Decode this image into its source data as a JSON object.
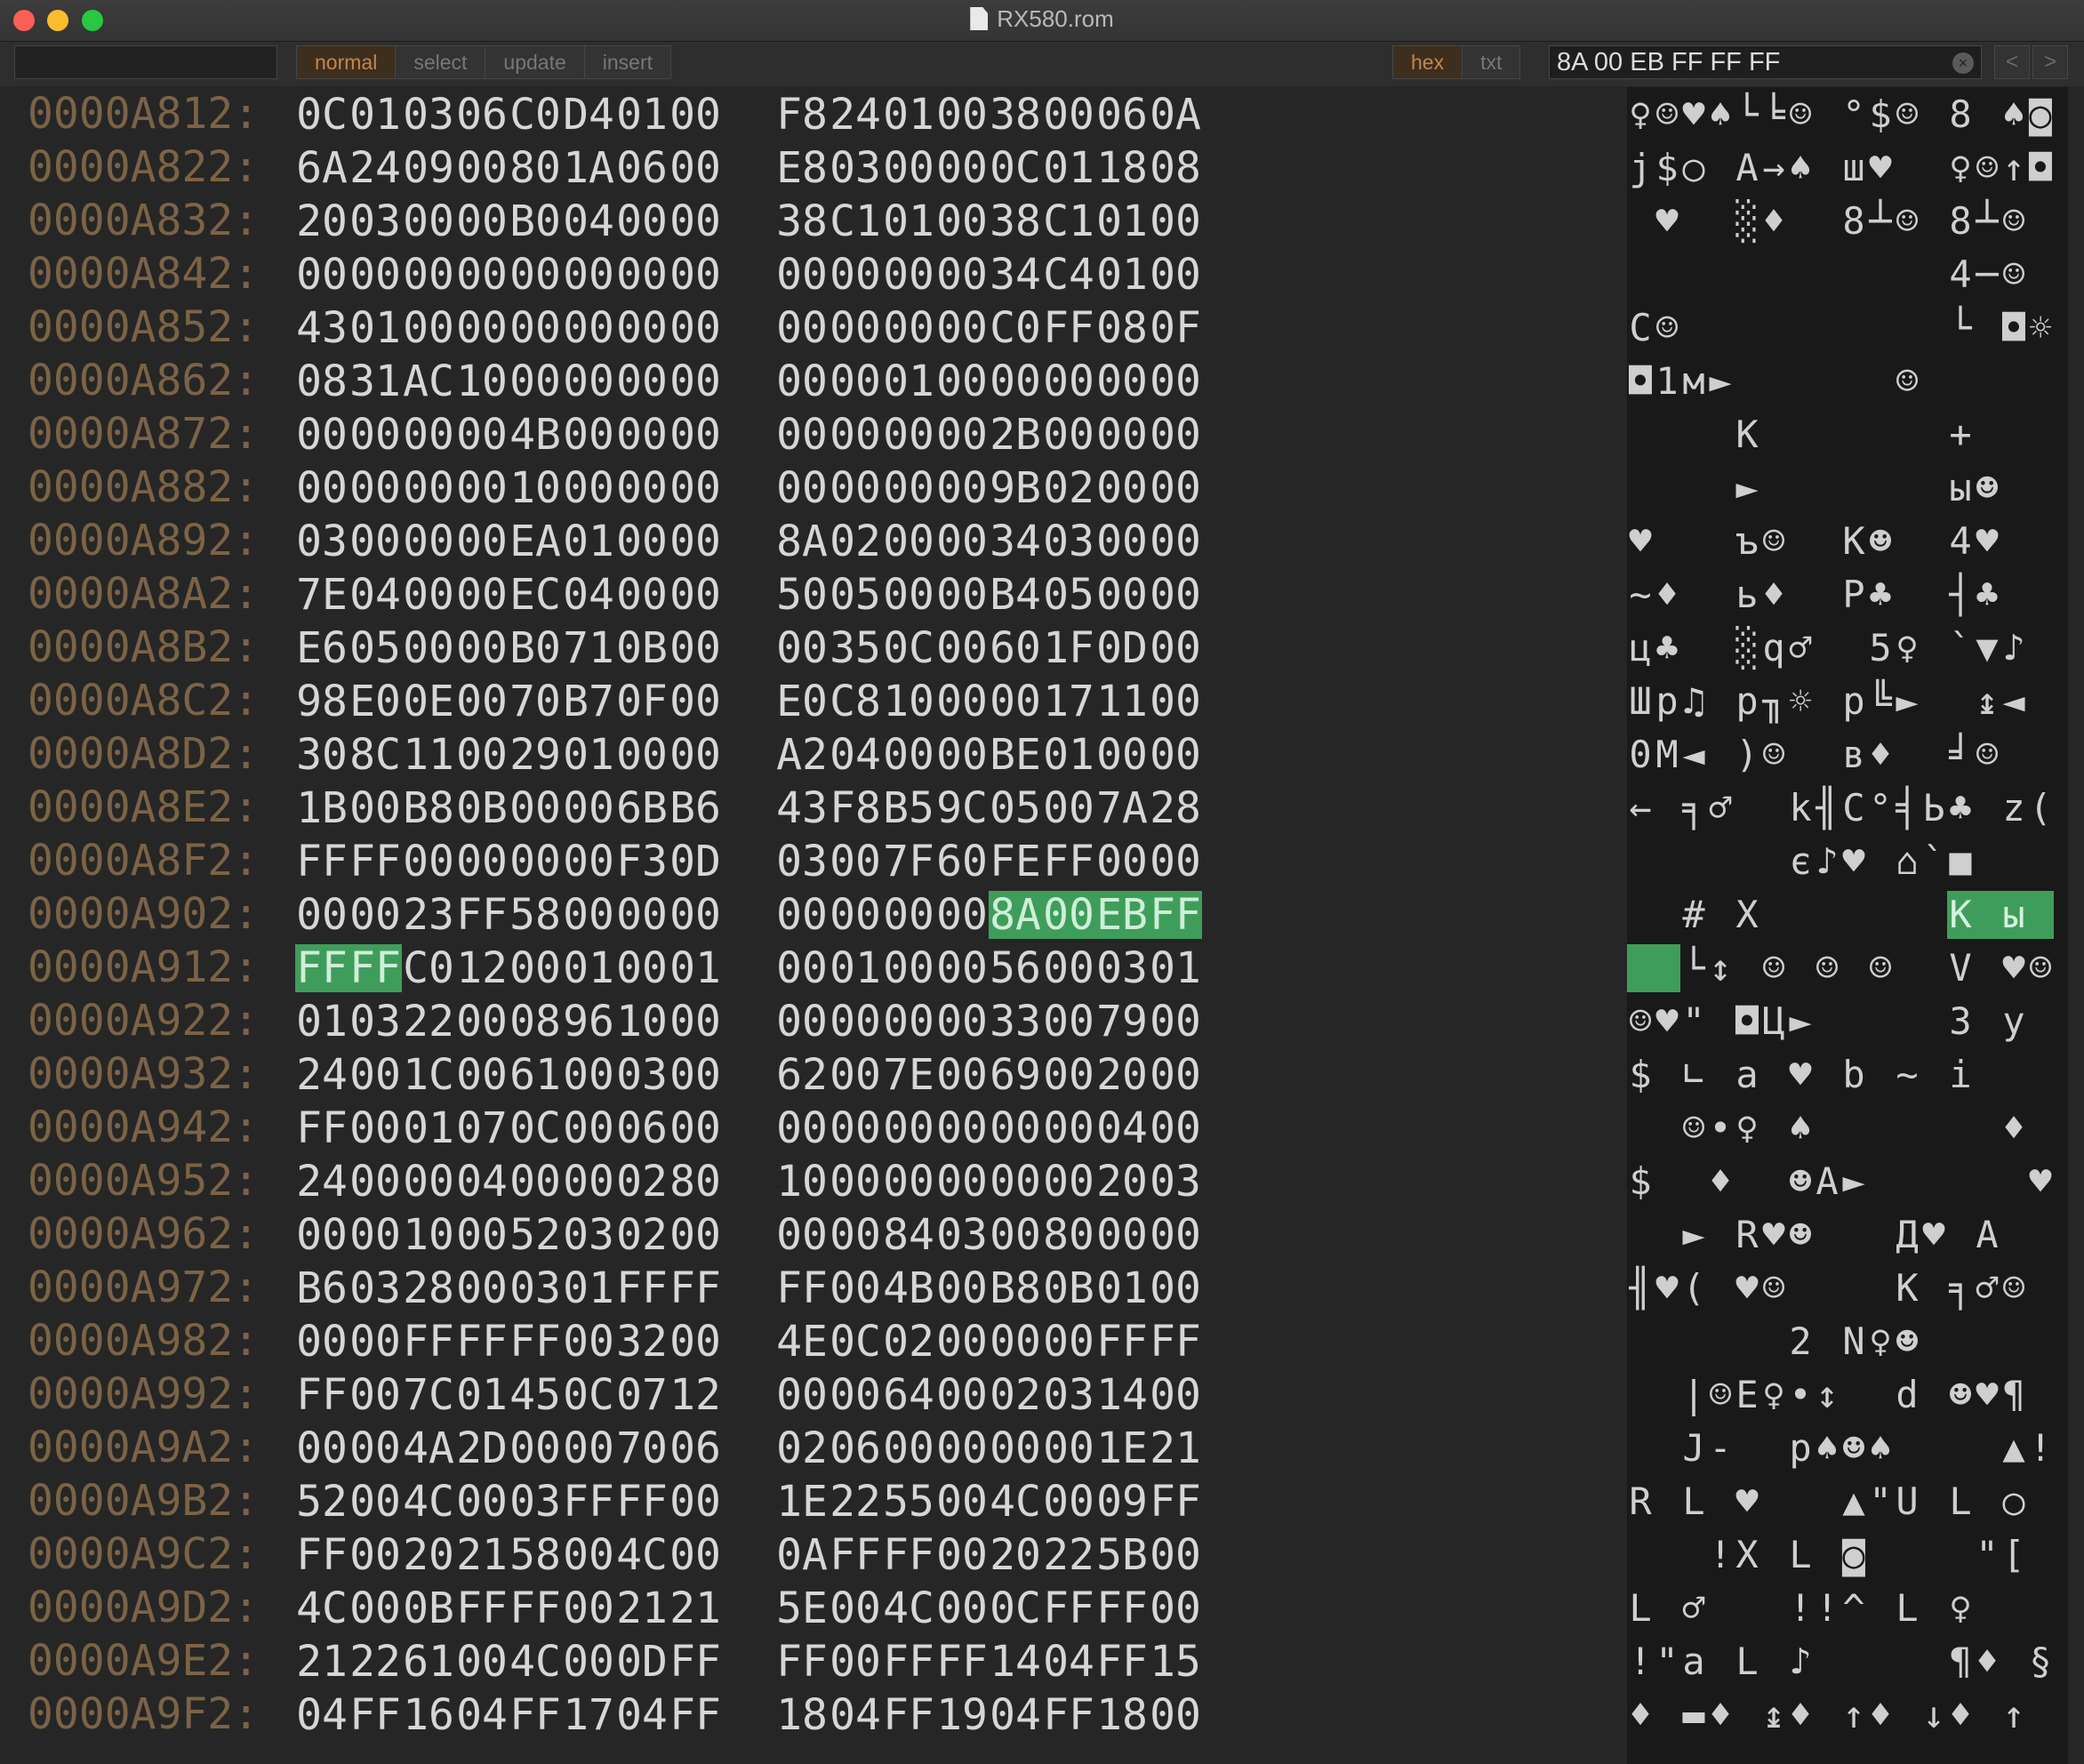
{
  "window": {
    "title": "RX580.rom"
  },
  "toolbar": {
    "modes": [
      {
        "label": "normal",
        "active": true
      },
      {
        "label": "select",
        "active": false
      },
      {
        "label": "update",
        "active": false
      },
      {
        "label": "insert",
        "active": false
      }
    ],
    "views": [
      {
        "label": "hex",
        "active": true
      },
      {
        "label": "txt",
        "active": false
      }
    ],
    "search_value": "8A 00 EB FF FF FF",
    "prev_label": "<",
    "next_label": ">"
  },
  "colors": {
    "background": "#262626",
    "address": "#7b6346",
    "highlight": "#3f9d5b",
    "active_mode": "#c2874d"
  },
  "rows": [
    {
      "address": "0000A812:",
      "bytes": [
        "0C",
        "01",
        "03",
        "06",
        "C0",
        "D4",
        "01",
        "00",
        "F8",
        "24",
        "01",
        "00",
        "38",
        "00",
        "06",
        "0A"
      ],
      "ascii": [
        "♀",
        "☺",
        "♥",
        "♠",
        "└",
        "╘",
        "☺",
        " ",
        "°",
        "$",
        "☺",
        " ",
        "8",
        " ",
        "♠",
        "◙"
      ]
    },
    {
      "address": "0000A822:",
      "bytes": [
        "6A",
        "24",
        "09",
        "00",
        "80",
        "1A",
        "06",
        "00",
        "E8",
        "03",
        "00",
        "00",
        "0C",
        "01",
        "18",
        "08"
      ],
      "ascii": [
        "j",
        "$",
        "○",
        " ",
        "А",
        "→",
        "♠",
        " ",
        "ш",
        "♥",
        " ",
        " ",
        "♀",
        "☺",
        "↑",
        "◘"
      ]
    },
    {
      "address": "0000A832:",
      "bytes": [
        "20",
        "03",
        "00",
        "00",
        "B0",
        "04",
        "00",
        "00",
        "38",
        "C1",
        "01",
        "00",
        "38",
        "C1",
        "01",
        "00"
      ],
      "ascii": [
        " ",
        "♥",
        " ",
        " ",
        "░",
        "♦",
        " ",
        " ",
        "8",
        "┴",
        "☺",
        " ",
        "8",
        "┴",
        "☺",
        " "
      ]
    },
    {
      "address": "0000A842:",
      "bytes": [
        "00",
        "00",
        "00",
        "00",
        "00",
        "00",
        "00",
        "00",
        "00",
        "00",
        "00",
        "00",
        "34",
        "C4",
        "01",
        "00"
      ],
      "ascii": [
        " ",
        " ",
        " ",
        " ",
        " ",
        " ",
        " ",
        " ",
        " ",
        " ",
        " ",
        " ",
        "4",
        "─",
        "☺",
        " "
      ]
    },
    {
      "address": "0000A852:",
      "bytes": [
        "43",
        "01",
        "00",
        "00",
        "00",
        "00",
        "00",
        "00",
        "00",
        "00",
        "00",
        "00",
        "C0",
        "FF",
        "08",
        "0F"
      ],
      "ascii": [
        "C",
        "☺",
        " ",
        " ",
        " ",
        " ",
        " ",
        " ",
        " ",
        " ",
        " ",
        " ",
        "└",
        " ",
        "◘",
        "☼"
      ]
    },
    {
      "address": "0000A862:",
      "bytes": [
        "08",
        "31",
        "AC",
        "10",
        "00",
        "00",
        "00",
        "00",
        "00",
        "00",
        "01",
        "00",
        "00",
        "00",
        "00",
        "00"
      ],
      "ascii": [
        "◘",
        "1",
        "м",
        "►",
        " ",
        " ",
        " ",
        " ",
        " ",
        " ",
        "☺",
        " ",
        " ",
        " ",
        " ",
        " "
      ]
    },
    {
      "address": "0000A872:",
      "bytes": [
        "00",
        "00",
        "00",
        "00",
        "4B",
        "00",
        "00",
        "00",
        "00",
        "00",
        "00",
        "00",
        "2B",
        "00",
        "00",
        "00"
      ],
      "ascii": [
        " ",
        " ",
        " ",
        " ",
        "K",
        " ",
        " ",
        " ",
        " ",
        " ",
        " ",
        " ",
        "+",
        " ",
        " ",
        " "
      ]
    },
    {
      "address": "0000A882:",
      "bytes": [
        "00",
        "00",
        "00",
        "00",
        "10",
        "00",
        "00",
        "00",
        "00",
        "00",
        "00",
        "00",
        "9B",
        "02",
        "00",
        "00"
      ],
      "ascii": [
        " ",
        " ",
        " ",
        " ",
        "►",
        " ",
        " ",
        " ",
        " ",
        " ",
        " ",
        " ",
        "ы",
        "☻",
        " ",
        " "
      ]
    },
    {
      "address": "0000A892:",
      "bytes": [
        "03",
        "00",
        "00",
        "00",
        "EA",
        "01",
        "00",
        "00",
        "8A",
        "02",
        "00",
        "00",
        "34",
        "03",
        "00",
        "00"
      ],
      "ascii": [
        "♥",
        " ",
        " ",
        " ",
        "ъ",
        "☺",
        " ",
        " ",
        "К",
        "☻",
        " ",
        " ",
        "4",
        "♥",
        " ",
        " "
      ]
    },
    {
      "address": "0000A8A2:",
      "bytes": [
        "7E",
        "04",
        "00",
        "00",
        "EC",
        "04",
        "00",
        "00",
        "50",
        "05",
        "00",
        "00",
        "B4",
        "05",
        "00",
        "00"
      ],
      "ascii": [
        "~",
        "♦",
        " ",
        " ",
        "ь",
        "♦",
        " ",
        " ",
        "P",
        "♣",
        " ",
        " ",
        "┤",
        "♣",
        " ",
        " "
      ]
    },
    {
      "address": "0000A8B2:",
      "bytes": [
        "E6",
        "05",
        "00",
        "00",
        "B0",
        "71",
        "0B",
        "00",
        "00",
        "35",
        "0C",
        "00",
        "60",
        "1F",
        "0D",
        "00"
      ],
      "ascii": [
        "ц",
        "♣",
        " ",
        " ",
        "░",
        "q",
        "♂",
        " ",
        " ",
        "5",
        "♀",
        " ",
        "`",
        "▼",
        "♪",
        " "
      ]
    },
    {
      "address": "0000A8C2:",
      "bytes": [
        "98",
        "E0",
        "0E",
        "00",
        "70",
        "B7",
        "0F",
        "00",
        "E0",
        "C8",
        "10",
        "00",
        "00",
        "17",
        "11",
        "00"
      ],
      "ascii": [
        "Ш",
        "р",
        "♫",
        " ",
        "p",
        "╖",
        "☼",
        " ",
        "р",
        "╚",
        "►",
        " ",
        " ",
        "↨",
        "◄",
        " "
      ]
    },
    {
      "address": "0000A8D2:",
      "bytes": [
        "30",
        "8C",
        "11",
        "00",
        "29",
        "01",
        "00",
        "00",
        "A2",
        "04",
        "00",
        "00",
        "BE",
        "01",
        "00",
        "00"
      ],
      "ascii": [
        "0",
        "М",
        "◄",
        " ",
        ")",
        "☺",
        " ",
        " ",
        "в",
        "♦",
        " ",
        " ",
        "╛",
        "☺",
        " ",
        " "
      ]
    },
    {
      "address": "0000A8E2:",
      "bytes": [
        "1B",
        "00",
        "B8",
        "0B",
        "00",
        "00",
        "6B",
        "B6",
        "43",
        "F8",
        "B5",
        "9C",
        "05",
        "00",
        "7A",
        "28"
      ],
      "ascii": [
        "←",
        " ",
        "╕",
        "♂",
        " ",
        " ",
        "k",
        "╢",
        "C",
        "°",
        "╡",
        "Ь",
        "♣",
        " ",
        "z",
        "("
      ]
    },
    {
      "address": "0000A8F2:",
      "bytes": [
        "FF",
        "FF",
        "00",
        "00",
        "00",
        "00",
        "F3",
        "0D",
        "03",
        "00",
        "7F",
        "60",
        "FE",
        "FF",
        "00",
        "00"
      ],
      "ascii": [
        " ",
        " ",
        " ",
        " ",
        " ",
        " ",
        "є",
        "♪",
        "♥",
        " ",
        "⌂",
        "`",
        "■",
        " ",
        " ",
        " "
      ]
    },
    {
      "address": "0000A902:",
      "bytes": [
        "00",
        "00",
        "23",
        "FF",
        "58",
        "00",
        "00",
        "00",
        "00",
        "00",
        "00",
        "00",
        "8A",
        "00",
        "EB",
        "FF"
      ],
      "ascii": [
        " ",
        " ",
        "#",
        " ",
        "X",
        " ",
        " ",
        " ",
        " ",
        " ",
        " ",
        " ",
        "К",
        " ",
        "ы",
        " "
      ]
    },
    {
      "address": "0000A912:",
      "bytes": [
        "FF",
        "FF",
        "C0",
        "12",
        "00",
        "01",
        "00",
        "01",
        "00",
        "01",
        "00",
        "00",
        "56",
        "00",
        "03",
        "01"
      ],
      "ascii": [
        " ",
        " ",
        "└",
        "↕",
        " ",
        "☺",
        " ",
        "☺",
        " ",
        "☺",
        " ",
        " ",
        "V",
        " ",
        "♥",
        "☺"
      ]
    },
    {
      "address": "0000A922:",
      "bytes": [
        "01",
        "03",
        "22",
        "00",
        "08",
        "96",
        "10",
        "00",
        "00",
        "00",
        "00",
        "00",
        "33",
        "00",
        "79",
        "00"
      ],
      "ascii": [
        "☺",
        "♥",
        "\"",
        " ",
        "◘",
        "Ц",
        "►",
        " ",
        " ",
        " ",
        " ",
        " ",
        "3",
        " ",
        "y",
        " "
      ]
    },
    {
      "address": "0000A932:",
      "bytes": [
        "24",
        "00",
        "1C",
        "00",
        "61",
        "00",
        "03",
        "00",
        "62",
        "00",
        "7E",
        "00",
        "69",
        "00",
        "20",
        "00"
      ],
      "ascii": [
        "$",
        " ",
        "∟",
        " ",
        "a",
        " ",
        "♥",
        " ",
        "b",
        " ",
        "~",
        " ",
        "i",
        " ",
        " ",
        " "
      ]
    },
    {
      "address": "0000A942:",
      "bytes": [
        "FF",
        "00",
        "01",
        "07",
        "0C",
        "00",
        "06",
        "00",
        "00",
        "00",
        "00",
        "00",
        "00",
        "00",
        "04",
        "00"
      ],
      "ascii": [
        " ",
        " ",
        "☺",
        "•",
        "♀",
        " ",
        "♠",
        " ",
        " ",
        " ",
        " ",
        " ",
        " ",
        " ",
        "♦",
        " "
      ]
    },
    {
      "address": "0000A952:",
      "bytes": [
        "24",
        "00",
        "00",
        "04",
        "00",
        "00",
        "02",
        "80",
        "10",
        "00",
        "00",
        "00",
        "00",
        "00",
        "20",
        "03"
      ],
      "ascii": [
        "$",
        " ",
        " ",
        "♦",
        " ",
        " ",
        "☻",
        "А",
        "►",
        " ",
        " ",
        " ",
        " ",
        " ",
        " ",
        "♥"
      ]
    },
    {
      "address": "0000A962:",
      "bytes": [
        "00",
        "00",
        "10",
        "00",
        "52",
        "03",
        "02",
        "00",
        "00",
        "00",
        "84",
        "03",
        "00",
        "80",
        "00",
        "00"
      ],
      "ascii": [
        " ",
        " ",
        "►",
        " ",
        "R",
        "♥",
        "☻",
        " ",
        " ",
        " ",
        "Д",
        "♥",
        " ",
        "А",
        " ",
        " "
      ]
    },
    {
      "address": "0000A972:",
      "bytes": [
        "B6",
        "03",
        "28",
        "00",
        "03",
        "01",
        "FF",
        "FF",
        "FF",
        "00",
        "4B",
        "00",
        "B8",
        "0B",
        "01",
        "00"
      ],
      "ascii": [
        "╢",
        "♥",
        "(",
        " ",
        "♥",
        "☺",
        " ",
        " ",
        " ",
        " ",
        "K",
        " ",
        "╕",
        "♂",
        "☺",
        " "
      ]
    },
    {
      "address": "0000A982:",
      "bytes": [
        "00",
        "00",
        "FF",
        "FF",
        "FF",
        "00",
        "32",
        "00",
        "4E",
        "0C",
        "02",
        "00",
        "00",
        "00",
        "FF",
        "FF"
      ],
      "ascii": [
        " ",
        " ",
        " ",
        " ",
        " ",
        " ",
        "2",
        " ",
        "N",
        "♀",
        "☻",
        " ",
        " ",
        " ",
        " ",
        " "
      ]
    },
    {
      "address": "0000A992:",
      "bytes": [
        "FF",
        "00",
        "7C",
        "01",
        "45",
        "0C",
        "07",
        "12",
        "00",
        "00",
        "64",
        "00",
        "02",
        "03",
        "14",
        "00"
      ],
      "ascii": [
        " ",
        " ",
        "|",
        "☺",
        "E",
        "♀",
        "•",
        "↕",
        " ",
        " ",
        "d",
        " ",
        "☻",
        "♥",
        "¶",
        " "
      ]
    },
    {
      "address": "0000A9A2:",
      "bytes": [
        "00",
        "00",
        "4A",
        "2D",
        "00",
        "00",
        "70",
        "06",
        "02",
        "06",
        "00",
        "00",
        "00",
        "00",
        "1E",
        "21"
      ],
      "ascii": [
        " ",
        " ",
        "J",
        "-",
        " ",
        " ",
        "p",
        "♠",
        "☻",
        "♠",
        " ",
        " ",
        " ",
        " ",
        "▲",
        "!"
      ]
    },
    {
      "address": "0000A9B2:",
      "bytes": [
        "52",
        "00",
        "4C",
        "00",
        "03",
        "FF",
        "FF",
        "00",
        "1E",
        "22",
        "55",
        "00",
        "4C",
        "00",
        "09",
        "FF"
      ],
      "ascii": [
        "R",
        " ",
        "L",
        " ",
        "♥",
        " ",
        " ",
        " ",
        "▲",
        "\"",
        "U",
        " ",
        "L",
        " ",
        "○",
        " "
      ]
    },
    {
      "address": "0000A9C2:",
      "bytes": [
        "FF",
        "00",
        "20",
        "21",
        "58",
        "00",
        "4C",
        "00",
        "0A",
        "FF",
        "FF",
        "00",
        "20",
        "22",
        "5B",
        "00"
      ],
      "ascii": [
        " ",
        " ",
        " ",
        "!",
        "X",
        " ",
        "L",
        " ",
        "◙",
        " ",
        " ",
        " ",
        " ",
        "\"",
        "[",
        " "
      ]
    },
    {
      "address": "0000A9D2:",
      "bytes": [
        "4C",
        "00",
        "0B",
        "FF",
        "FF",
        "00",
        "21",
        "21",
        "5E",
        "00",
        "4C",
        "00",
        "0C",
        "FF",
        "FF",
        "00"
      ],
      "ascii": [
        "L",
        " ",
        "♂",
        " ",
        " ",
        " ",
        "!",
        "!",
        "^",
        " ",
        "L",
        " ",
        "♀",
        " ",
        " ",
        " "
      ]
    },
    {
      "address": "0000A9E2:",
      "bytes": [
        "21",
        "22",
        "61",
        "00",
        "4C",
        "00",
        "0D",
        "FF",
        "FF",
        "00",
        "FF",
        "FF",
        "14",
        "04",
        "FF",
        "15"
      ],
      "ascii": [
        "!",
        "\"",
        "a",
        " ",
        "L",
        " ",
        "♪",
        " ",
        " ",
        " ",
        " ",
        " ",
        "¶",
        "♦",
        " ",
        "§"
      ]
    },
    {
      "address": "0000A9F2:",
      "bytes": [
        "04",
        "FF",
        "16",
        "04",
        "FF",
        "17",
        "04",
        "FF",
        "18",
        "04",
        "FF",
        "19",
        "04",
        "FF",
        "18",
        "00"
      ],
      "ascii": [
        "♦",
        " ",
        "▬",
        "♦",
        " ",
        "↨",
        "♦",
        " ",
        "↑",
        "♦",
        " ",
        "↓",
        "♦",
        " ",
        "↑",
        " "
      ]
    }
  ],
  "highlights": [
    [
      15,
      12
    ],
    [
      15,
      13
    ],
    [
      15,
      14
    ],
    [
      15,
      15
    ],
    [
      16,
      0
    ],
    [
      16,
      1
    ]
  ]
}
